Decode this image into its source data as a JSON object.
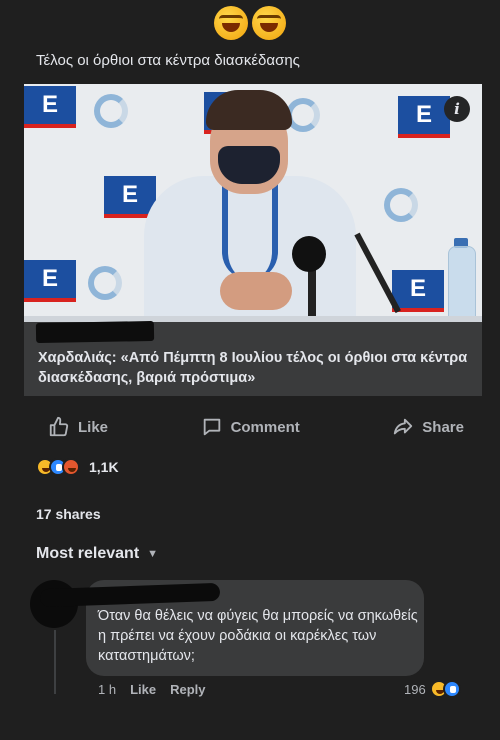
{
  "header": {
    "emojis": [
      "rolling-on-floor-laughing-icon",
      "rolling-on-floor-laughing-icon"
    ],
    "post_text": "Τέλος οι όρθιοι στα κέντρα διασκέδασης"
  },
  "link_card": {
    "info_label": "i",
    "title": "Χαρδαλιάς: «Από Πέμπτη 8 Ιουλίου τέλος οι όρθιοι στα κέντρα διασκέδασης, βαριά πρόστιμα»"
  },
  "actions": {
    "like": "Like",
    "comment": "Comment",
    "share": "Share"
  },
  "reactions": {
    "icons": [
      "haha-icon",
      "like-icon",
      "angry-icon"
    ],
    "count": "1,1K"
  },
  "shares": "17 shares",
  "sort": {
    "label": "Most relevant"
  },
  "comment": {
    "text": "Όταν θα θέλεις να φύγεις θα μπορείς να σηκωθείς η πρέπει να έχουν ροδάκια οι καρέκλες των καταστημάτων;",
    "time": "1 h",
    "like": "Like",
    "reply": "Reply",
    "reaction_count": "196"
  },
  "colors": {
    "background": "#1f1f1f",
    "card": "#3a3b3c",
    "text": "#e4e6eb",
    "muted": "#b0b3b8",
    "accent_blue": "#2d88ff",
    "logo_blue": "#1c4fa0"
  }
}
